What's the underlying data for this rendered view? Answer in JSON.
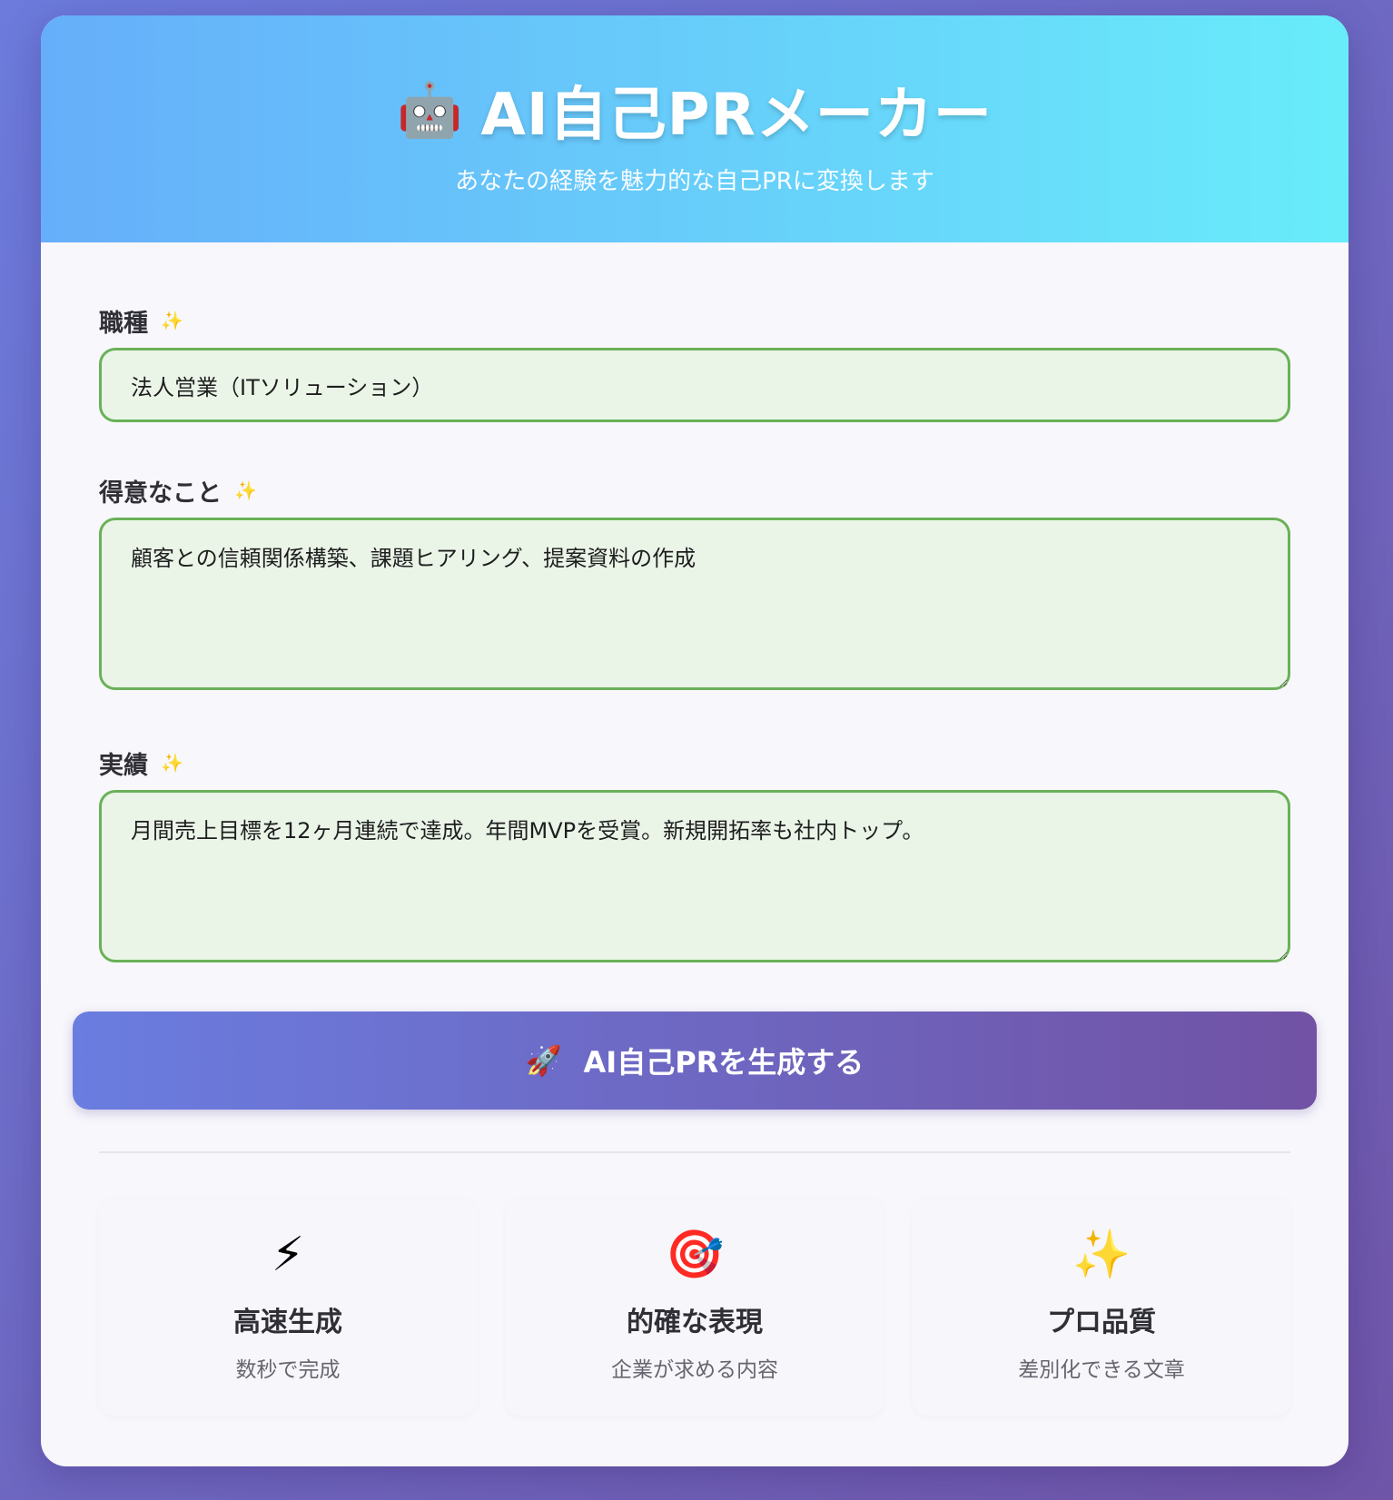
{
  "header": {
    "icon": "robot-icon",
    "icon_glyph": "🤖",
    "title": "AI自己PRメーカー",
    "subtitle": "あなたの経験を魅力的な自己PRに変換します"
  },
  "form": {
    "job": {
      "label": "職種",
      "sparkle": "✨",
      "value": "法人営業（ITソリューション）"
    },
    "strengths": {
      "label": "得意なこと",
      "sparkle": "✨",
      "value": "顧客との信頼関係構築、課題ヒアリング、提案資料の作成"
    },
    "achievements": {
      "label": "実績",
      "sparkle": "✨",
      "value": "月間売上目標を12ヶ月連続で達成。年間MVPを受賞。新規開拓率も社内トップ。"
    }
  },
  "generate_button": {
    "icon": "rocket-icon",
    "icon_glyph": "🚀",
    "label": "AI自己PRを生成する"
  },
  "features": [
    {
      "icon": "lightning-icon",
      "icon_glyph": "⚡",
      "title": "高速生成",
      "desc": "数秒で完成"
    },
    {
      "icon": "target-icon",
      "icon_glyph": "🎯",
      "title": "的確な表現",
      "desc": "企業が求める内容"
    },
    {
      "icon": "sparkles-icon",
      "icon_glyph": "✨",
      "title": "プロ品質",
      "desc": "差別化できる文章"
    }
  ],
  "colors": {
    "page_bg_start": "#6c7bdc",
    "page_bg_end": "#6f55a8",
    "header_start": "#66aefa",
    "header_end": "#68ecfa",
    "field_border": "#6ab159",
    "field_bg": "#eaf5e8",
    "button_start": "#6a7de0",
    "button_end": "#7152a4"
  }
}
